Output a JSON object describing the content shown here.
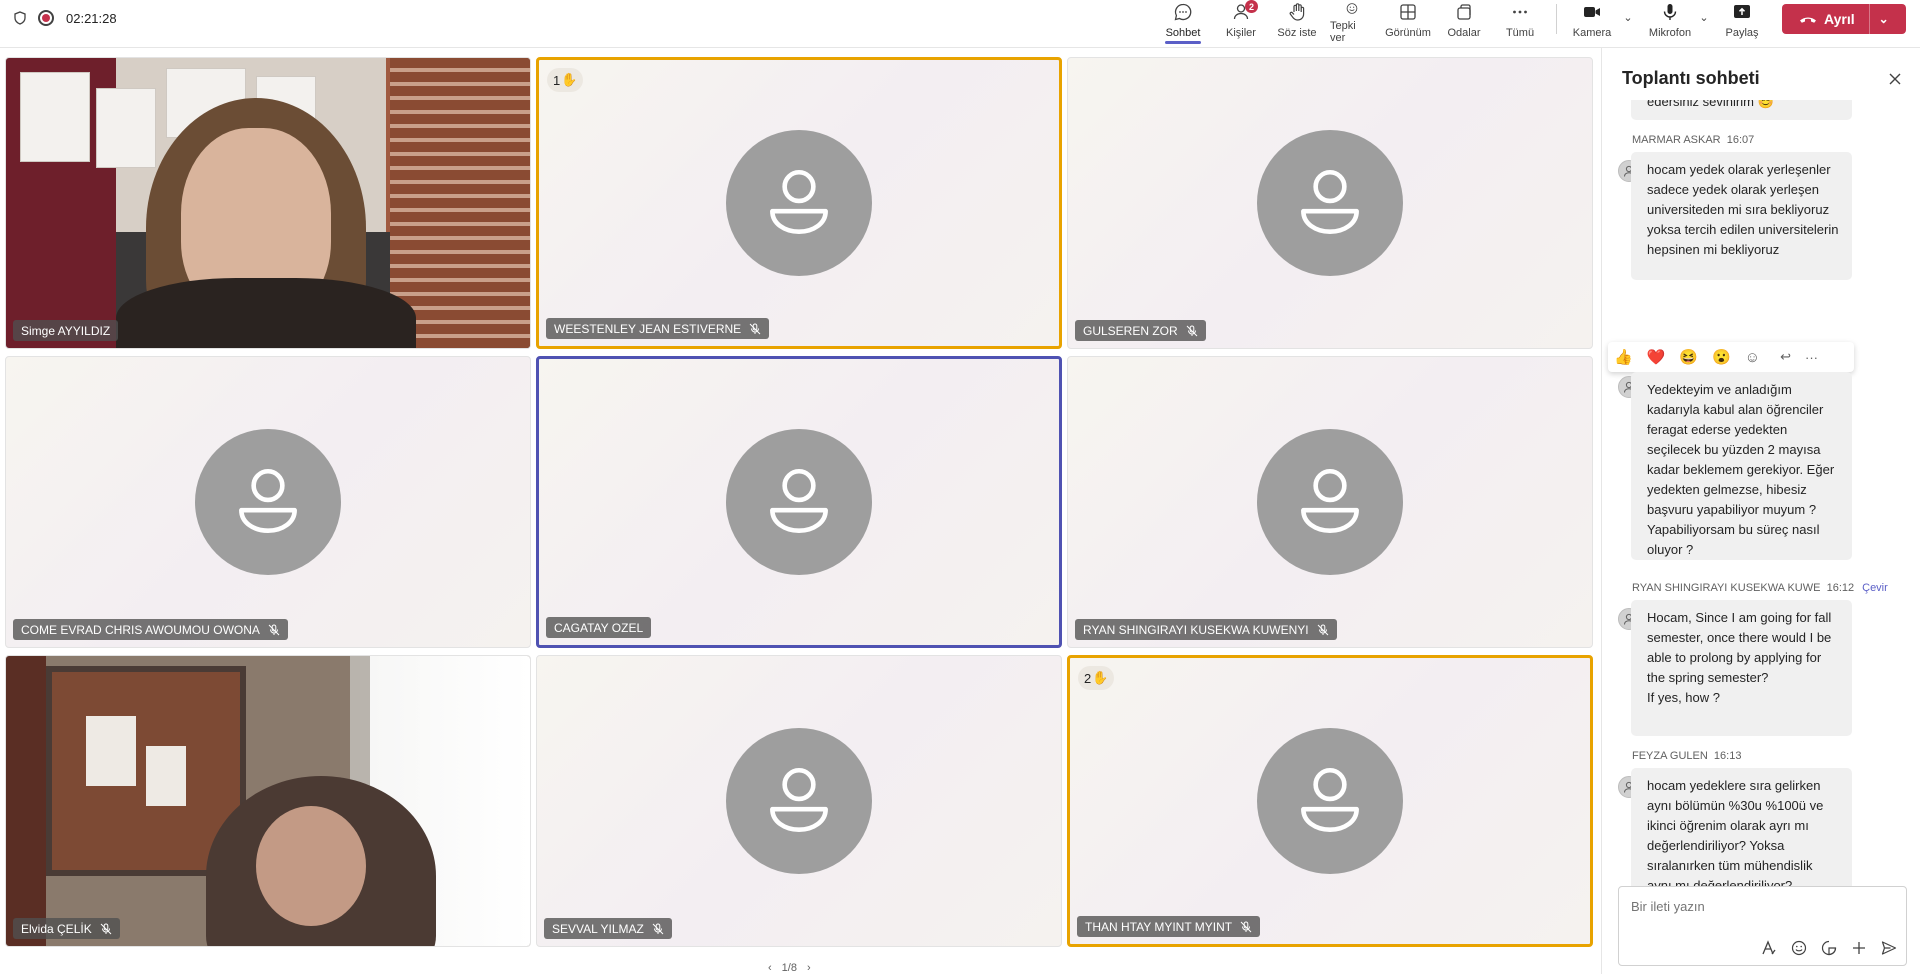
{
  "topbar": {
    "timer": "02:21:28",
    "buttons": {
      "chat": "Sohbet",
      "people": "Kişiler",
      "people_badge": "2",
      "raise": "Söz iste",
      "react": "Tepki ver",
      "view": "Görünüm",
      "rooms": "Odalar",
      "more": "Tümü",
      "camera": "Kamera",
      "mic": "Mikrofon",
      "share": "Paylaş"
    },
    "leave": "Ayrıl",
    "leave_color": "#c4314b",
    "accent_color": "#5b5fc7"
  },
  "participants": [
    {
      "name": "Simge AYYILDIZ",
      "muted": false,
      "video": true
    },
    {
      "name": "WEESTENLEY JEAN ESTIVERNE",
      "muted": true,
      "hand": "1",
      "hand_icon": "✋"
    },
    {
      "name": "GULSEREN ZOR",
      "muted": true
    },
    {
      "name": "COME EVRAD CHRIS AWOUMOU OWONA",
      "muted": true
    },
    {
      "name": "CAGATAY OZEL",
      "muted": false,
      "speaking": true
    },
    {
      "name": "RYAN SHINGIRAYI KUSEKWA KUWENYI",
      "muted": true
    },
    {
      "name": "Elvida ÇELİK",
      "muted": true,
      "video": true
    },
    {
      "name": "SEVVAL YILMAZ",
      "muted": true
    },
    {
      "name": "THAN HTAY MYINT MYINT",
      "muted": true,
      "hand": "2",
      "hand_icon": "✋"
    }
  ],
  "pager": {
    "prev": "‹",
    "label": "1/8",
    "next": "›"
  },
  "chat": {
    "title": "Toplantı sohbeti",
    "partial_message": "edersiniz sevinirim 😊",
    "messages": [
      {
        "author": "MARMAR ASKAR",
        "time": "16:07",
        "text": "hocam yedek olarak yerleşenler sadece yedek olarak yerleşen universiteden mi sıra bekliyoruz yoksa tercih edilen universitelerin hepsinen mi bekliyoruz"
      },
      {
        "author": "",
        "time": "",
        "text": "Yedekteyim ve anladığım kadarıyla kabul alan öğrenciler feragat ederse yedekten seçilecek bu yüzden 2 mayısa kadar beklemem gerekiyor. Eğer yedekten gelmezse, hibesiz başvuru yapabiliyor muyum ? Yapabiliyorsam bu süreç nasıl oluyor ?"
      },
      {
        "author": "RYAN SHINGIRAYI KUSEKWA KUWE",
        "time": "16:12",
        "translate": "Çevir",
        "text": "Hocam, Since I am going for fall semester, once there would I be able to prolong by applying for the spring semester?",
        "text2": "If yes, how ?"
      },
      {
        "author": "FEYZA GULEN",
        "time": "16:13",
        "text": "hocam yedeklere sıra gelirken aynı bölümün %30u %100ü ve ikinci öğrenim olarak ayrı mı değerlendiriliyor? Yoksa sıralanırken tüm mühendislik aynı mı değerlendiriliyor?"
      }
    ],
    "reactions": [
      "👍",
      "❤️",
      "😆",
      "😮",
      "☺"
    ],
    "reaction_actions": [
      "↩",
      "···"
    ],
    "composer_placeholder": "Bir ileti yazın"
  }
}
